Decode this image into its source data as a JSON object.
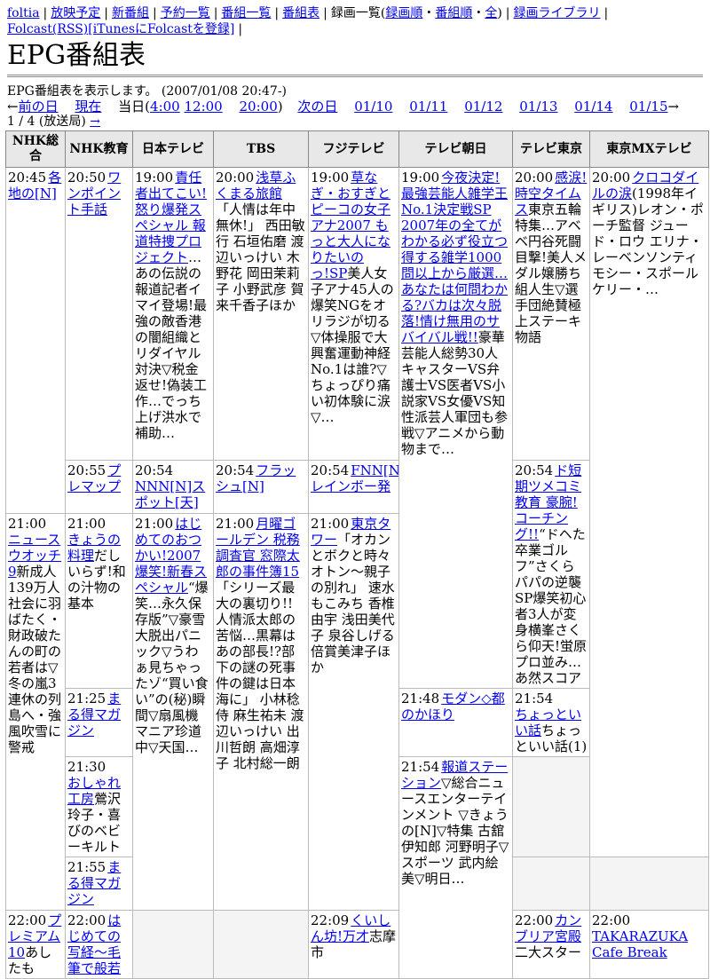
{
  "nav": {
    "foltia": "foltia",
    "yoyaku": "放映予定",
    "shinbangumi": "新番組",
    "yoyakulist": "予約一覧",
    "bangumilist": "番組一覧",
    "bangumihyo": "番組表",
    "rokuga_prefix": "録画一覧(",
    "rokuga_junban": "録画順",
    "dot1": "・",
    "rokuga_bangumi": "番組順",
    "dot2": "・",
    "rokuga_all": "全",
    "rokuga_suffix": ")",
    "library": "録画ライブラリ",
    "folcast": "Folcast(RSS)",
    "itunes": "[iTunesにFolcastを登録]"
  },
  "page": {
    "title": "EPG番組表",
    "description": "EPG番組表を表示します。 (2007/01/08 20:47-)",
    "prev_arrow": "←",
    "prev": "前の日",
    "now": "現在",
    "today_prefix": "当日(",
    "t1": "4:00",
    "t2": "12:00",
    "t3": "20:00",
    "today_suffix": ")",
    "next": "次の日",
    "dates": [
      "01/10",
      "01/11",
      "01/12",
      "01/13",
      "01/14",
      "01/15"
    ],
    "next_arrow": "→",
    "pageinfo": "1 / 4 (放送局)",
    "page_arrow": "→"
  },
  "channels": [
    "NHK総合",
    "NHK教育",
    "日本テレビ",
    "TBS",
    "フジテレビ",
    "テレビ朝日",
    "テレビ東京",
    "東京MXテレビ"
  ],
  "programs": {
    "c0_2045_time": "20:45",
    "c0_2045_title": "各地の[N]",
    "c0_2100_time": "21:00",
    "c0_2100_title": "ニュースウオッチ9",
    "c0_2100_desc": "新成人139万人社会に羽ばたく・財政破たんの町の若者は▽冬の嵐3連休の列島へ・強風吹雪に警戒",
    "c0_2200_time": "22:00",
    "c0_2200_title": "プレミアム10",
    "c0_2200_desc": "あしたも",
    "c1_2050_time": "20:50",
    "c1_2050_title": "ワンポイント手話",
    "c1_2055_time": "20:55",
    "c1_2055_title": "プレマップ",
    "c1_2100_time": "21:00",
    "c1_2100_title": "きょうの料理",
    "c1_2100_desc": "だしいらず!和の汁物の基本",
    "c1_2125_time": "21:25",
    "c1_2125_title": "まる得マガジン",
    "c1_2130_time": "21:30",
    "c1_2130_title": "おしゃれ工房",
    "c1_2130_desc": "鶯沢玲子・喜びのベビーキルト",
    "c1_2155_time": "21:55",
    "c1_2155_title": "まる得マガジン",
    "c1_2200_time": "22:00",
    "c1_2200_title": "はじめての写経〜毛筆で般若",
    "c2_1900_time": "19:00",
    "c2_1900_title": "責任者出てこい!怒り爆発スペシャル 報道特捜プロジェクト",
    "c2_1900_desc": "…あの伝説の報道記者イマイ登場!最強の敵香港の闇組織とリダイヤル対決▽税金返せ!偽装工作…でっち上げ洪水で補助…",
    "c2_2054_time": "20:54",
    "c2_2054_title": "NNN[N]スポット[天]",
    "c2_2100_time": "21:00",
    "c2_2100_title": "はじめてのおつかい!2007爆笑!新春スペシャル",
    "c2_2100_desc": "“爆笑…永久保存版”▽豪雪大脱出パニック▽うわぁ見ちゃったゾ“買い食い”の(秘)瞬間▽扇風機マニア珍道中▽天国…",
    "c3_2000_time": "20:00",
    "c3_2000_title": "浅草ふくまる旅館",
    "c3_2000_desc": "「人情は年中無休!」 西田敏行 石垣佑磨 渡辺いっけい 木野花 岡田茉莉子 小野武彦 賀来千香子ほか",
    "c3_2054_time": "20:54",
    "c3_2054_title": "フラッシュ[N]",
    "c3_2100_time": "21:00",
    "c3_2100_title": "月曜ゴールデン 税務調査官 窓際太郎の事件簿15",
    "c3_2100_desc": "「シリーズ最大の裏切り!!人情派太郎の苦悩…黒幕はあの部長!?部下の謎の死事件の鍵は日本海に」 小林稔侍 麻生祐未 渡辺いっけい 出川哲朗 高畑淳子 北村総一朗",
    "c4_1900_time": "19:00",
    "c4_1900_title": "草なぎ・おすぎとピーコの女子アナ2007 もっと大人になりたいのっ!SP",
    "c4_1900_desc": "美人女子アナ45人の爆笑NGをオリラジが切る▽体操服で大興奮運動神経No.1は誰?▽ちょっぴり痛い初体験に涙▽…",
    "c4_2054_time": "20:54",
    "c4_2054_title": "FNN[N]レインボー発",
    "c4_2100_time": "21:00",
    "c4_2100_title": "東京タワー",
    "c4_2100_desc": "「オカンとボクと時々オトン〜親子の別れ」 速水もこみち 香椎由宇 浅田美代子 泉谷しげる 倍賞美津子ほか",
    "c4_2209_time": "22:09",
    "c4_2209_title": "くいしん坊!万才",
    "c4_2209_desc": "志摩市",
    "c5_1900_time": "19:00",
    "c5_1900_title": "今夜決定!最強芸能人雑学王No.1決定戦SP 2007年の全てがわかる必ず役立つ得する雑学1000問以上から厳選…あなたは何問わかる?バカは次々脱落!情け無用のサバイバル戦!!",
    "c5_1900_desc": "豪華芸能人総勢30人キャスターVS弁護士VS医者VS小説家VS女優VS知性派芸人軍団も参戦▽アニメから動物まで…",
    "c5_2148_time": "21:48",
    "c5_2148_title": "モダン◇都のかほり",
    "c5_2154_time": "21:54",
    "c5_2154_title": "報道ステーション",
    "c5_2154_desc": "▽総合ニュースエンターテインメント ▽きょうの[N]▽特集 古舘伊知郎 河野明子▽スポーツ 武内絵美▽明日…",
    "c6_2000_time": "20:00",
    "c6_2000_title": "感涙!時空タイムス",
    "c6_2000_desc": "東京五輪特集…アベベ円谷死闘目撃!美人メダル嬢勝ち組人生▽選手団絶賛極上ステーキ物語",
    "c6_2054_time": "20:54",
    "c6_2054_title": "ド短期ツメコミ教育 豪腕!コーチング!!",
    "c6_2054_desc": "“ドヘた卒業ゴルフ”さくらパパの逆襲SP爆笑初心者3人が変身横峯さくら仰天!蛍原プロ並み…あ然スコア",
    "c6_2154_time": "21:54",
    "c6_2154_title": "ちょっといい話",
    "c6_2154_desc": "ちょっといい話(1)",
    "c6_2200_time": "22:00",
    "c6_2200_title": "カンブリア宮殿",
    "c6_2200_desc": "二大スター",
    "c7_2000_time": "20:00",
    "c7_2000_title": "クロコダイルの涙",
    "c7_2000_desc": "(1998年イギリス)レオン・ポーチ監督 ジュード・ロウ エリナ・レーベンソンティモシー・スポール ケリー・…",
    "c7_2200_time": "22:00",
    "c7_2200_title": "TAKARAZUKA Cafe Break"
  }
}
